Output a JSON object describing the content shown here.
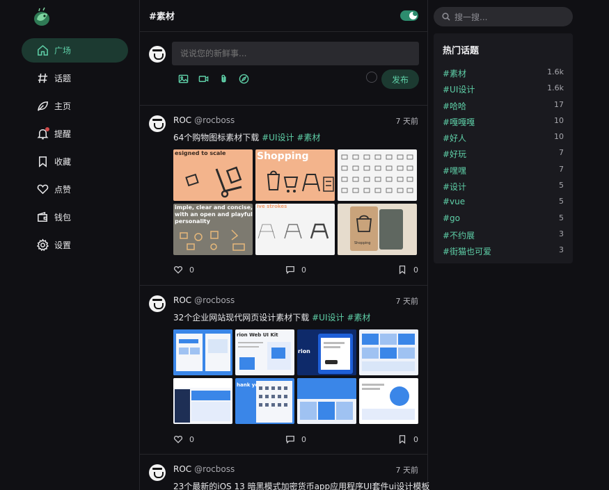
{
  "sidebar": {
    "items": [
      {
        "label": "广场",
        "icon": "home-icon",
        "active": true
      },
      {
        "label": "话题",
        "icon": "hash-icon"
      },
      {
        "label": "主页",
        "icon": "leaf-icon"
      },
      {
        "label": "提醒",
        "icon": "bell-icon",
        "badge": true
      },
      {
        "label": "收藏",
        "icon": "bookmark-icon"
      },
      {
        "label": "点赞",
        "icon": "heart-icon"
      },
      {
        "label": "钱包",
        "icon": "wallet-icon"
      },
      {
        "label": "设置",
        "icon": "gear-icon"
      }
    ]
  },
  "header": {
    "title": "#素材"
  },
  "composer": {
    "placeholder": "说说您的新鲜事...",
    "publish_label": "发布"
  },
  "posts": [
    {
      "name": "ROC",
      "handle": "@rocboss",
      "time": "7 天前",
      "text": "64个购物图标素材下载",
      "tags": [
        "#UI设计",
        "#素材"
      ],
      "likes": "0",
      "comments": "0",
      "collections": "0"
    },
    {
      "name": "ROC",
      "handle": "@rocboss",
      "time": "7 天前",
      "text": "32个企业网站现代网页设计素材下载",
      "tags": [
        "#UI设计",
        "#素材"
      ],
      "likes": "0",
      "comments": "0",
      "collections": "0"
    },
    {
      "name": "ROC",
      "handle": "@rocboss",
      "time": "7 天前",
      "text": "23个最新的iOS 13 暗黑模式加密货币app应用程序UI套件ui设计模板"
    }
  ],
  "thumbs_post1": {
    "t1": "esigned to scale",
    "t2": "Shopping",
    "t4a": "imple, clear and concise,",
    "t4b": "with an open and playful",
    "t4c": "personality",
    "t5": "ive strokes",
    "t6": "Shopping"
  },
  "thumbs_post2": {
    "t2": "rion Web UI Kit",
    "t3": "rion",
    "t5": "hank you"
  },
  "search": {
    "placeholder": "搜一搜..."
  },
  "topics": {
    "title": "热门话题",
    "items": [
      {
        "tag": "#素材",
        "count": "1.6k"
      },
      {
        "tag": "#UI设计",
        "count": "1.6k"
      },
      {
        "tag": "#哈哈",
        "count": "17"
      },
      {
        "tag": "#嘎嘎嘎",
        "count": "10"
      },
      {
        "tag": "#好人",
        "count": "10"
      },
      {
        "tag": "#好玩",
        "count": "7"
      },
      {
        "tag": "#嘿嘿",
        "count": "7"
      },
      {
        "tag": "#设计",
        "count": "5"
      },
      {
        "tag": "#vue",
        "count": "5"
      },
      {
        "tag": "#go",
        "count": "5"
      },
      {
        "tag": "#不约展",
        "count": "3"
      },
      {
        "tag": "#街猫也可爱",
        "count": "3"
      }
    ]
  },
  "colors": {
    "accent": "#5fd0a8",
    "accent_bg": "#1c3a31",
    "background": "#101014",
    "panel": "#1a1a1f"
  }
}
